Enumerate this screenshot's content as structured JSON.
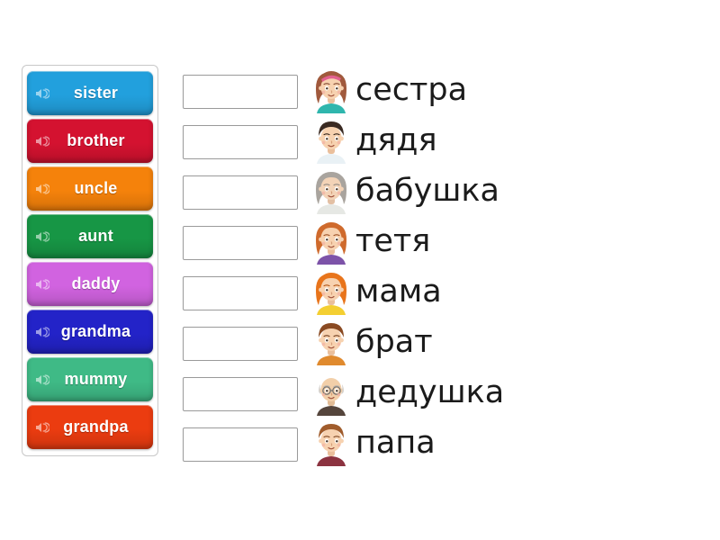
{
  "activity": {
    "type": "match-up-quiz",
    "title": "Family members English to Russian matching"
  },
  "word_bank": {
    "name": "draggable-word-tiles",
    "icon": "speaker-icon",
    "tiles": [
      {
        "label": "sister",
        "color": "#22a0dd",
        "audio_icon": "speaker-icon"
      },
      {
        "label": "brother",
        "color": "#d41230",
        "audio_icon": "speaker-icon"
      },
      {
        "label": "uncle",
        "color": "#f5820b",
        "audio_icon": "speaker-icon"
      },
      {
        "label": "aunt",
        "color": "#179645",
        "audio_icon": "speaker-icon"
      },
      {
        "label": "daddy",
        "color": "#d163e0",
        "audio_icon": "speaker-icon"
      },
      {
        "label": "grandma",
        "color": "#2323c8",
        "audio_icon": "speaker-icon"
      },
      {
        "label": "mummy",
        "color": "#3fba86",
        "audio_icon": "speaker-icon"
      },
      {
        "label": "grandpa",
        "color": "#eb3c10",
        "audio_icon": "speaker-icon"
      }
    ]
  },
  "answers": [
    {
      "value": "",
      "placeholder": ""
    },
    {
      "value": "",
      "placeholder": ""
    },
    {
      "value": "",
      "placeholder": ""
    },
    {
      "value": "",
      "placeholder": ""
    },
    {
      "value": "",
      "placeholder": ""
    },
    {
      "value": "",
      "placeholder": ""
    },
    {
      "value": "",
      "placeholder": ""
    },
    {
      "value": "",
      "placeholder": ""
    }
  ],
  "prompts": [
    {
      "word": "сестра",
      "avatar": "girl-brown-pink-hair-teal-shirt-avatar"
    },
    {
      "word": "дядя",
      "avatar": "man-dark-hair-white-shirt-avatar"
    },
    {
      "word": "бабушка",
      "avatar": "elderly-woman-gray-hair-avatar"
    },
    {
      "word": "тетя",
      "avatar": "woman-auburn-hair-purple-shirt-avatar"
    },
    {
      "word": "мама",
      "avatar": "woman-orange-hair-yellow-shirt-avatar"
    },
    {
      "word": "брат",
      "avatar": "boy-brown-hair-orange-shirt-avatar"
    },
    {
      "word": "дедушка",
      "avatar": "elderly-man-glasses-bald-avatar"
    },
    {
      "word": "папа",
      "avatar": "man-brown-hair-maroon-shirt-avatar"
    }
  ],
  "colors": {
    "page_background": "#ffffff",
    "panel_border": "#c8c8c8",
    "input_border": "#9a9a9a",
    "prompt_text": "#1b1b1b",
    "tile_text": "#ffffff"
  }
}
